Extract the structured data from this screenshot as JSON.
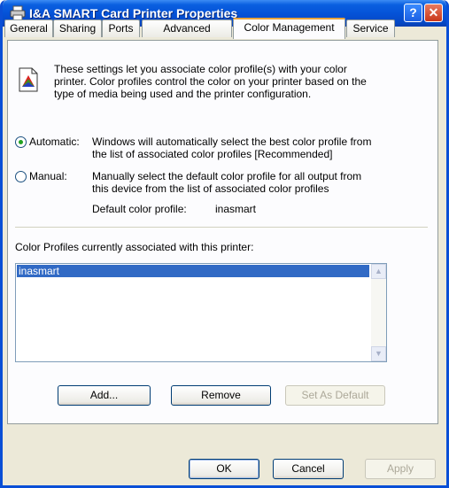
{
  "window": {
    "title": "I&A SMART Card Printer Properties",
    "help_glyph": "?",
    "close_glyph": "✕"
  },
  "tabs": [
    {
      "label": "General"
    },
    {
      "label": "Sharing"
    },
    {
      "label": "Ports"
    },
    {
      "label": "Advanced"
    },
    {
      "label": "Color Management",
      "active": true
    },
    {
      "label": "Service"
    }
  ],
  "panel": {
    "intro_lines": [
      "These settings let you associate color profile(s) with your color",
      "printer. Color profiles control the color on your printer based on the",
      "type of media being used and the printer configuration."
    ],
    "automatic": {
      "label": "Automatic:",
      "selected": true,
      "desc_lines": [
        "Windows will automatically select the best color profile from",
        "the list of associated color profiles [Recommended]"
      ]
    },
    "manual": {
      "label": "Manual:",
      "selected": false,
      "desc_lines": [
        "Manually select the default color profile for all output from",
        "this device from the list of associated color profiles"
      ],
      "default_profile_label": "Default color profile:",
      "default_profile_value": "inasmart"
    },
    "profiles_label": "Color Profiles currently associated with this printer:",
    "profiles": [
      "inasmart"
    ],
    "buttons": {
      "add": "Add...",
      "remove": "Remove",
      "set_default": "Set As Default"
    }
  },
  "footer": {
    "ok": "OK",
    "cancel": "Cancel",
    "apply": "Apply"
  },
  "colors": {
    "title_bar": "#0553d8",
    "window_bg": "#ece9d8",
    "selection": "#316ac5",
    "active_tab_accent": "#e8a33d"
  }
}
